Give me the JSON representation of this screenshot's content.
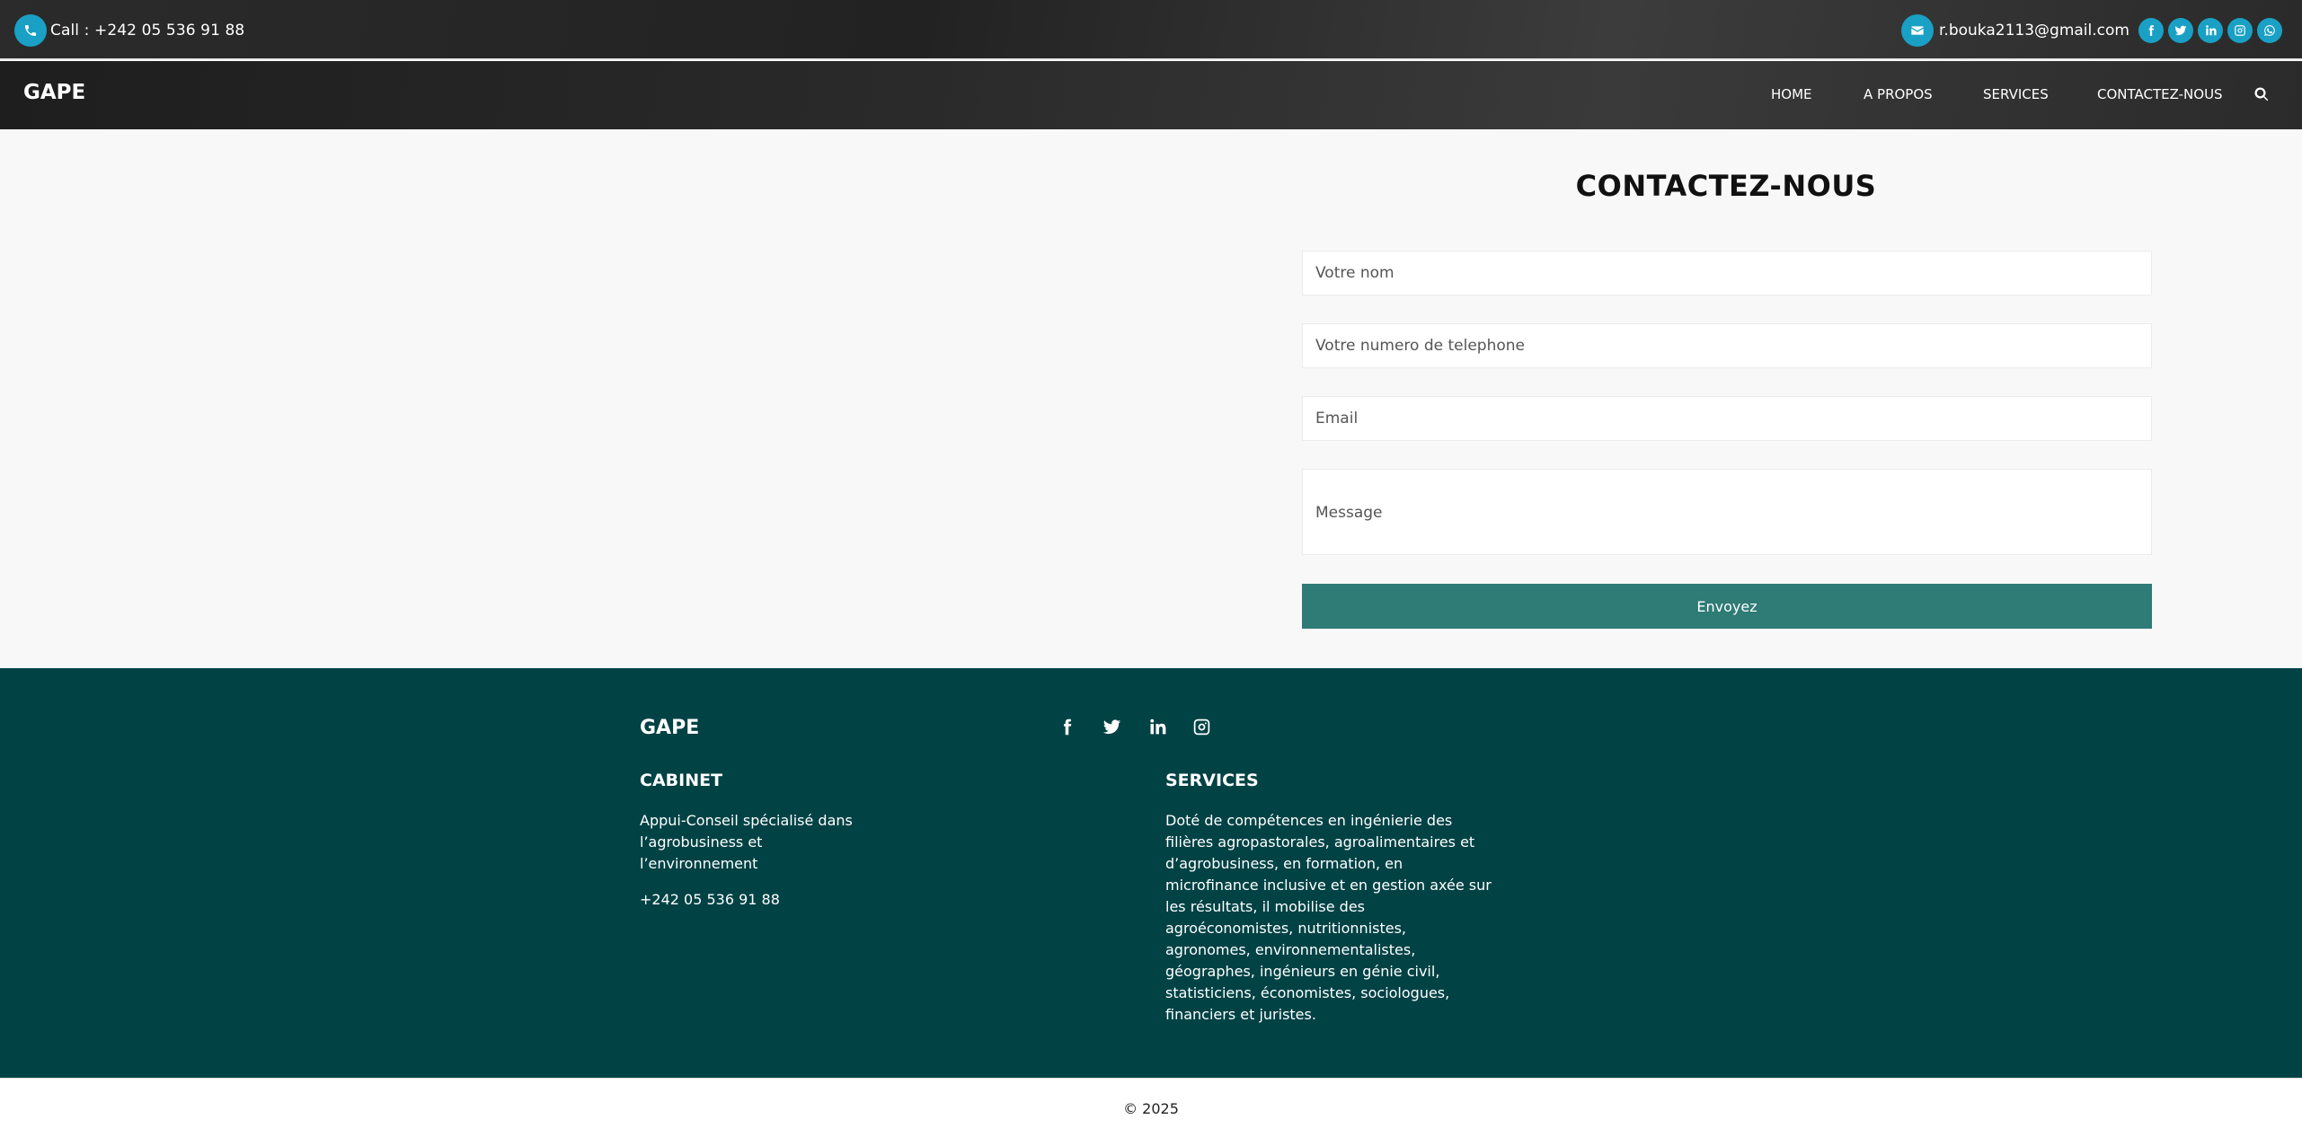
{
  "topbar": {
    "call_text": "Call : +242 05 536 91 88",
    "email": "r.bouka2113@gmail.com",
    "socials": [
      "facebook-icon",
      "twitter-icon",
      "linkedin-icon",
      "instagram-icon",
      "whatsapp-icon"
    ],
    "accent": "#1aa0c4"
  },
  "nav": {
    "brand": "GAPE",
    "links": [
      "HOME",
      "A PROPOS",
      "SERVICES",
      "CONTACTEZ-NOUS"
    ],
    "search_icon": "search-icon"
  },
  "contact": {
    "title": "CONTACTEZ-NOUS",
    "name_placeholder": "Votre nom",
    "phone_placeholder": "Votre numero de telephone",
    "email_placeholder": "Email",
    "message_placeholder": "Message",
    "submit_label": "Envoyez",
    "button_color": "#2f7b76"
  },
  "footer": {
    "brand": "GAPE",
    "socials": [
      "facebook-icon",
      "twitter-icon",
      "linkedin-icon",
      "instagram-icon"
    ],
    "cabinet": {
      "heading": "CABINET",
      "lines": [
        "Appui-Conseil spécialisé dans",
        "l’agrobusiness et",
        "l’environnement"
      ],
      "phone": "+242 05 536 91 88"
    },
    "services": {
      "heading": "SERVICES",
      "lines": [
        "Doté de compétences en ingénierie des",
        "filières agropastorales, agroalimentaires et",
        "d’agrobusiness, en formation, en",
        "microfinance inclusive et en gestion axée sur",
        "les résultats, il mobilise des",
        "agroéconomistes, nutritionnistes,",
        "agronomes, environnementalistes,",
        "géographes, ingénieurs en génie civil,",
        "statisticiens, économistes, sociologues,",
        "financiers et juristes."
      ]
    },
    "background": "#014245"
  },
  "bottom": {
    "copyright": "© 2025"
  }
}
